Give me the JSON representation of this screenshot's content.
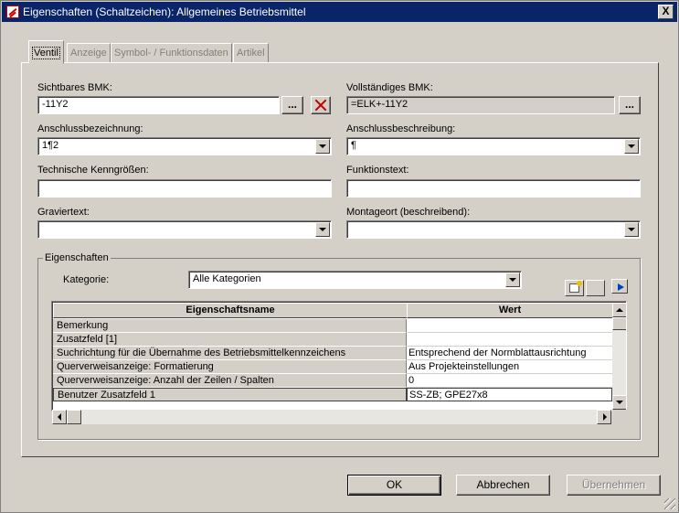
{
  "window": {
    "title": "Eigenschaften (Schaltzeichen): Allgemeines Betriebsmittel",
    "close_label": "X"
  },
  "tabs": [
    {
      "label": "Ventil",
      "active": true
    },
    {
      "label": "Anzeige",
      "active": false
    },
    {
      "label": "Symbol- / Funktionsdaten",
      "active": false
    },
    {
      "label": "Artikel",
      "active": false
    }
  ],
  "form": {
    "sichtbares_bmk": {
      "label": "Sichtbares BMK:",
      "value": "-11Y2",
      "browse_label": "..."
    },
    "vollstaendiges_bmk": {
      "label": "Vollständiges BMK:",
      "value": "=ELK+-11Y2",
      "browse_label": "..."
    },
    "anschlussbezeichnung": {
      "label": "Anschlussbezeichnung:",
      "value": "1¶2"
    },
    "anschlussbeschreibung": {
      "label": "Anschlussbeschreibung:",
      "value": "¶"
    },
    "technische_kenngroessen": {
      "label": "Technische Kenngrößen:",
      "value": ""
    },
    "funktionstext": {
      "label": "Funktionstext:",
      "value": ""
    },
    "graviertext": {
      "label": "Graviertext:",
      "value": ""
    },
    "montageort": {
      "label": "Montageort (beschreibend):",
      "value": ""
    }
  },
  "properties": {
    "group_label": "Eigenschaften",
    "category_label": "Kategorie:",
    "category_value": "Alle Kategorien",
    "columns": [
      "Eigenschaftsname",
      "Wert"
    ],
    "rows": [
      {
        "name": "Bemerkung",
        "value": ""
      },
      {
        "name": "Zusatzfeld [1]",
        "value": ""
      },
      {
        "name": "Suchrichtung für die Übernahme des Betriebsmittelkennzeichens",
        "value": "Entsprechend der Normblattausrichtung"
      },
      {
        "name": "Querverweisanzeige: Formatierung",
        "value": "Aus Projekteinstellungen"
      },
      {
        "name": "Querverweisanzeige: Anzahl der Zeilen / Spalten",
        "value": "0"
      },
      {
        "name": "Benutzer Zusatzfeld 1",
        "value": "SS-ZB; GPE27x8",
        "selected": true
      }
    ]
  },
  "buttons": {
    "ok": "OK",
    "cancel": "Abbrechen",
    "apply": "Übernehmen"
  },
  "colors": {
    "titlebar": "#0a246a",
    "face": "#d4d0c8",
    "delete_red": "#c00000"
  }
}
